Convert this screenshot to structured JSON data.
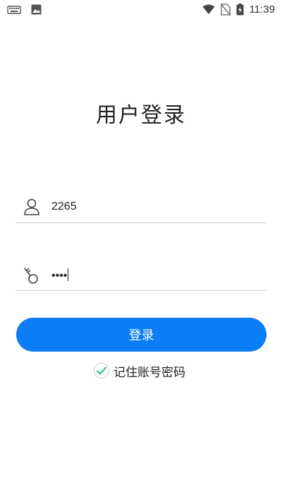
{
  "status_bar": {
    "time": "11:39",
    "left_icons": [
      "keyboard-icon",
      "image-icon"
    ],
    "right_icons": [
      "wifi-icon",
      "no-sim-icon",
      "battery-charging-icon"
    ]
  },
  "title": "用户登录",
  "username": {
    "icon": "user-icon",
    "value": "2265"
  },
  "password": {
    "icon": "key-icon",
    "value": "••••"
  },
  "login_button": {
    "label": "登录",
    "color": "#0b7df7"
  },
  "remember": {
    "label": "记住账号密码",
    "checked": true,
    "check_color": "#1cb87e"
  }
}
